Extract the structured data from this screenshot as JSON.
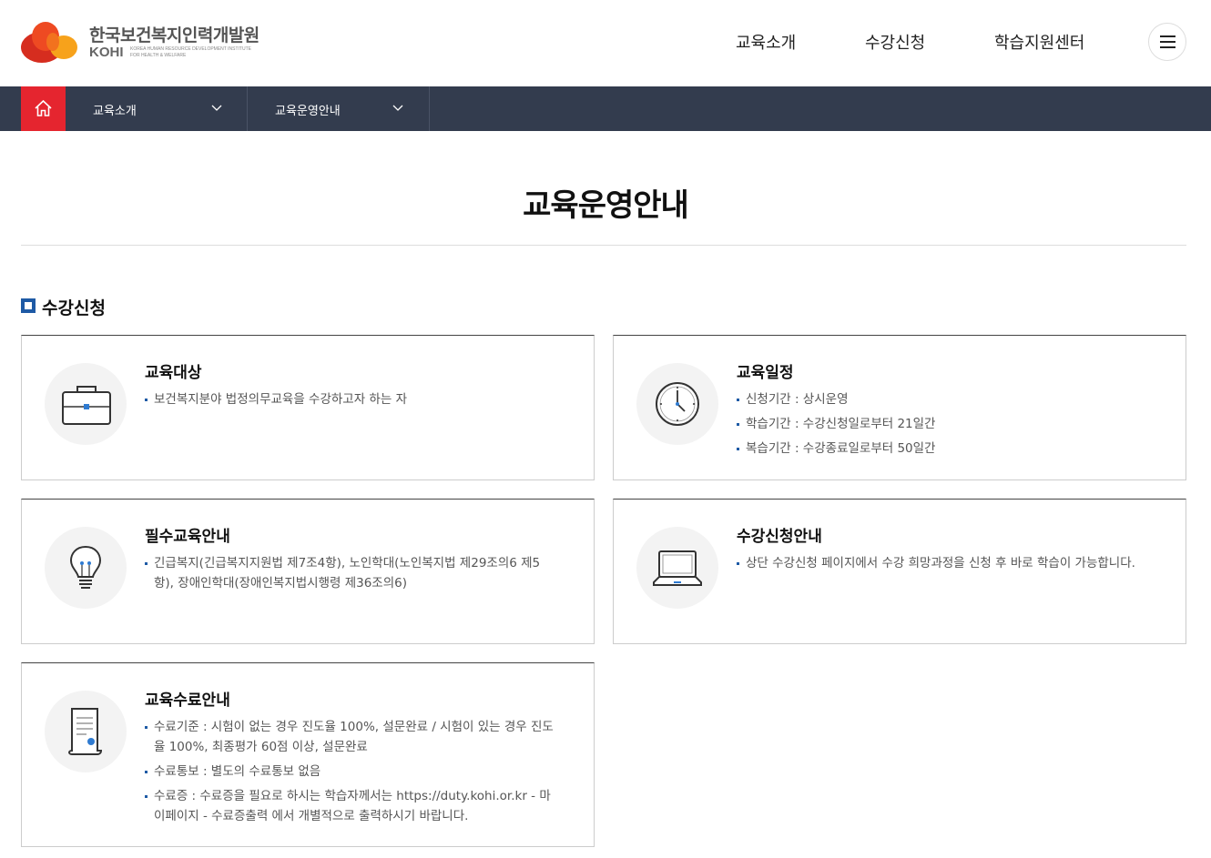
{
  "header": {
    "logo_kr": "한국보건복지인력개발원",
    "logo_en": "KOHI",
    "logo_sub_line1": "KOREA HUMAN RESOURCE DEVELOPMENT INSTITUTE",
    "logo_sub_line2": "FOR HEALTH & WELFARE",
    "nav": [
      "교육소개",
      "수강신청",
      "학습지원센터"
    ]
  },
  "breadcrumb": {
    "items": [
      "교육소개",
      "교육운영안내"
    ]
  },
  "page": {
    "title": "교육운영안내"
  },
  "section": {
    "title": "수강신청"
  },
  "cards": [
    {
      "icon": "briefcase-icon",
      "title": "교육대상",
      "items": [
        "보건복지분야 법정의무교육을 수강하고자 하는 자"
      ]
    },
    {
      "icon": "clock-icon",
      "title": "교육일정",
      "items": [
        "신청기간 : 상시운영",
        "학습기간 : 수강신청일로부터 21일간",
        "복습기간 : 수강종료일로부터 50일간"
      ]
    },
    {
      "icon": "lightbulb-icon",
      "title": "필수교육안내",
      "items": [
        "긴급복지(긴급복지지원법 제7조4항), 노인학대(노인복지법 제29조의6 제5항), 장애인학대(장애인복지법시행령 제36조의6)"
      ]
    },
    {
      "icon": "laptop-icon",
      "title": "수강신청안내",
      "items": [
        "상단 수강신청 페이지에서 수강 희망과정을 신청 후 바로 학습이 가능합니다."
      ]
    },
    {
      "icon": "certificate-icon",
      "title": "교육수료안내",
      "items": [
        "수료기준 : 시험이 없는 경우 진도율 100%, 설문완료 / 시험이 있는 경우 진도율 100%, 최종평가 60점 이상, 설문완료",
        "수료통보 : 별도의 수료통보 없음",
        "수료증 : 수료증을 필요로 하시는 학습자께서는 https://duty.kohi.or.kr - 마이페이지 - 수료증출력 에서 개별적으로 출력하시기 바랍니다."
      ]
    }
  ],
  "colors": {
    "bar_bg": "#333c4e",
    "home_red": "#e5252f",
    "accent_blue": "#1e5aa5"
  }
}
